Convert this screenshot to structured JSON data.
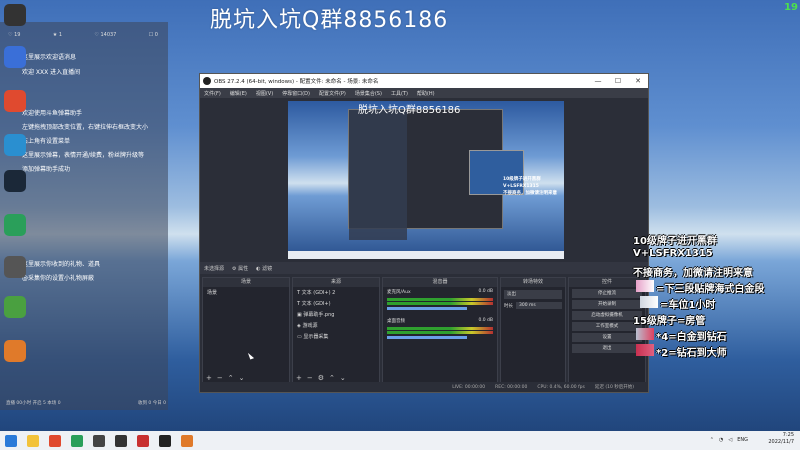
{
  "banner": "脱坑入坑Q群8856186",
  "corner_number": "19",
  "desktop_icons": [
    {
      "name": "obs-icon",
      "color": "#333333",
      "label": ""
    },
    {
      "name": "app-icon-1",
      "color": "#3a6fd8",
      "label": ""
    },
    {
      "name": "chrome-icon",
      "color": "#e04a2f",
      "label": ""
    },
    {
      "name": "edge-icon",
      "color": "#2a8fd0",
      "label": ""
    },
    {
      "name": "steam-icon",
      "color": "#1b2838",
      "label": ""
    },
    {
      "name": "app-icon-2",
      "color": "#2a9f5a",
      "label": ""
    },
    {
      "name": "app-icon-3",
      "color": "#555555",
      "label": ""
    },
    {
      "name": "app-icon-4",
      "color": "#4aa040",
      "label": ""
    },
    {
      "name": "app-icon-5",
      "color": "#e07a2a",
      "label": ""
    }
  ],
  "chat": {
    "stats": [
      "♡ 19",
      "★ 1",
      "♡ 14037",
      "☐ 0"
    ],
    "lines": [
      "这里展示欢迎语消息",
      "欢迎 XXX 进入直播间",
      "欢迎使用斗鱼弹幕助手",
      "左键拖拽顶部改变位置，右键拉伸右框改变大小",
      "右上角有设置菜单",
      "这里展示弹幕，表情开通/续费，粉丝牌升级等",
      "添加弹幕助手成功",
      "这里展示你收到的礼物、道具",
      "@采集你的设置小礼物屏蔽"
    ],
    "footer_left": "直播 00小时  开启 5  本场 0",
    "footer_right": "收到 0  今日 0"
  },
  "obs": {
    "title": "OBS 27.2.4 (64-bit, windows) - 配置文件: 未命名 - 场景: 未命名",
    "menu": [
      "文件(F)",
      "编辑(E)",
      "视图(V)",
      "停靠窗口(D)",
      "配置文件(P)",
      "场景集合(S)",
      "工具(T)",
      "帮助(H)"
    ],
    "toolbar_label": "未选择源",
    "toolbar_props": "属性",
    "toolbar_filters": "滤镜",
    "preview_banner": "脱坑入坑Q群8856186",
    "docks": {
      "scenes": {
        "title": "场景",
        "items": [
          "场景"
        ]
      },
      "sources": {
        "title": "来源",
        "items": [
          "文本 (GDI+) 2",
          "文本 (GDI+)",
          "弹幕助手.png",
          "游戏源",
          "显示器采集"
        ]
      },
      "mixer": {
        "title": "混音器",
        "channels": [
          {
            "name": "麦克风/Aux",
            "db": "0.0 dB"
          },
          {
            "name": "桌面音频",
            "db": "0.0 dB"
          }
        ]
      },
      "transitions": {
        "title": "转场特效",
        "type": "淡出",
        "duration_label": "时长",
        "duration_value": "300 ms"
      },
      "controls": {
        "title": "控件",
        "buttons": [
          "停止推流",
          "开始录制",
          "启动虚拟摄像机",
          "工作室模式",
          "设置",
          "退出"
        ]
      }
    },
    "status": [
      "LIVE: 00:00:00",
      "REC: 00:00:00",
      "CPU: 0.4%, 60.00 fps",
      "延迟 (10 秒后开始)"
    ]
  },
  "right_overlay": [
    "10级牌子进开黑群",
    "V+LSFRX1315",
    "不接商务，加微请注明来意",
    "=下三段贴牌海式白金段",
    "=车位1小时",
    "15级牌子=房管",
    "*4=白金到钻石",
    "*2=钻石到大师"
  ],
  "taskbar": {
    "apps": [
      {
        "name": "windows-start-icon",
        "color": "#2a7ad8"
      },
      {
        "name": "file-explorer-icon",
        "color": "#f2c23a"
      },
      {
        "name": "chrome-taskbar-icon",
        "color": "#e04a2f"
      },
      {
        "name": "app-taskbar-icon-1",
        "color": "#2a9f5a"
      },
      {
        "name": "app-taskbar-icon-2",
        "color": "#444444"
      },
      {
        "name": "app-taskbar-icon-3",
        "color": "#333333"
      },
      {
        "name": "app-taskbar-icon-4",
        "color": "#c83030"
      },
      {
        "name": "app-taskbar-icon-5",
        "color": "#222222"
      },
      {
        "name": "app-taskbar-icon-6",
        "color": "#e07a2a"
      }
    ],
    "lang": "ENG",
    "time": "7:25",
    "date": "2022/11/7"
  }
}
